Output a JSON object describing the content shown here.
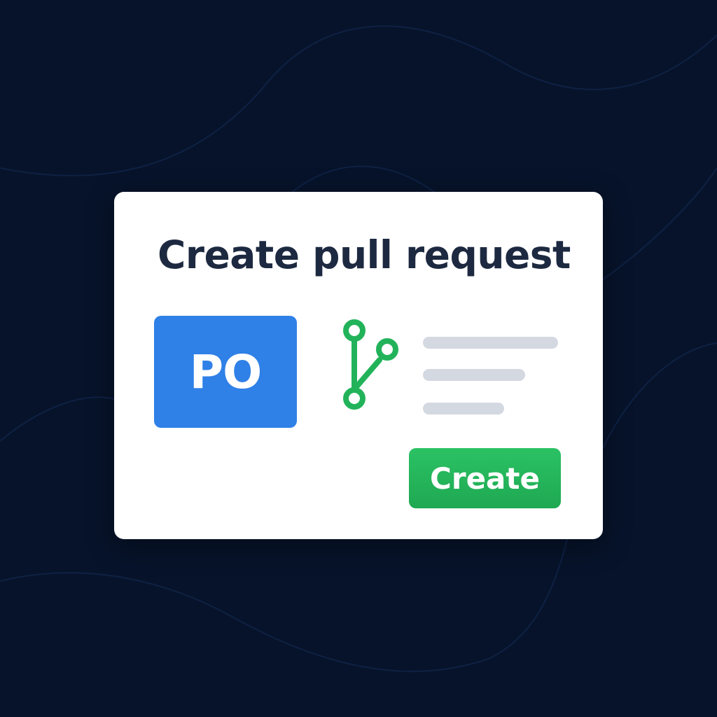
{
  "dialog": {
    "title": "Create pull request",
    "avatar_initials": "PO",
    "create_label": "Create"
  },
  "icons": {
    "branch": "git-branch-icon"
  },
  "colors": {
    "background": "#07132a",
    "card": "#ffffff",
    "title_text": "#1d2940",
    "avatar": "#2f80e7",
    "branch_icon": "#22b35a",
    "placeholder_lines": "#d3d8e1",
    "create_button": "#22b35a"
  }
}
